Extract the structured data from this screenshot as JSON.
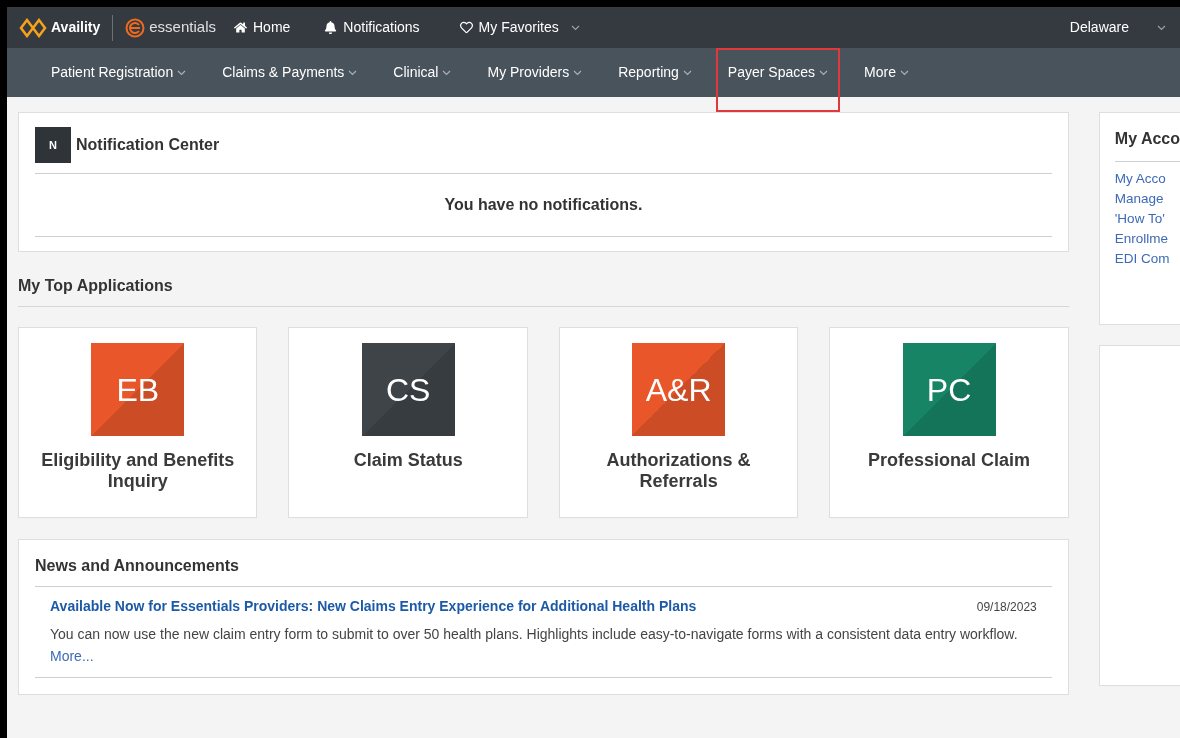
{
  "header": {
    "brand": "Availity",
    "product": "essentials",
    "links": [
      {
        "kind": "home",
        "label": "Home"
      },
      {
        "kind": "bell",
        "label": "Notifications"
      },
      {
        "kind": "heart",
        "label": "My Favorites",
        "dropdown": true
      }
    ],
    "region": "Delaware"
  },
  "nav": [
    {
      "label": "Patient Registration",
      "highlighted": false
    },
    {
      "label": "Claims & Payments",
      "highlighted": false
    },
    {
      "label": "Clinical",
      "highlighted": false
    },
    {
      "label": "My Providers",
      "highlighted": false
    },
    {
      "label": "Reporting",
      "highlighted": false
    },
    {
      "label": "Payer Spaces",
      "highlighted": true
    },
    {
      "label": "More",
      "highlighted": false
    }
  ],
  "notification_center": {
    "badge": "N",
    "title": "Notification Center",
    "message": "You have no notifications."
  },
  "top_applications": {
    "title": "My Top Applications",
    "apps": [
      {
        "code": "EB",
        "name": "Eligibility and Benefits Inquiry",
        "color": "#e8562a"
      },
      {
        "code": "CS",
        "name": "Claim Status",
        "color": "#3f4449"
      },
      {
        "code": "A&R",
        "name": "Authorizations & Referrals",
        "color": "#e8562a"
      },
      {
        "code": "PC",
        "name": "Professional Claim",
        "color": "#178466"
      }
    ]
  },
  "news": {
    "title": "News and Announcements",
    "items": [
      {
        "headline": "Available Now for Essentials Providers: New Claims Entry Experience for Additional Health Plans",
        "date": "09/18/2023",
        "body": "You can now use the new claim entry form to submit to over 50 health plans. Highlights include easy-to-navigate forms with a consistent data entry workflow.",
        "more": "More..."
      }
    ]
  },
  "side_panel": {
    "title": "My Acco",
    "links": [
      "My Acco",
      "Manage",
      "'How To'",
      "Enrollme",
      "EDI Com"
    ]
  }
}
